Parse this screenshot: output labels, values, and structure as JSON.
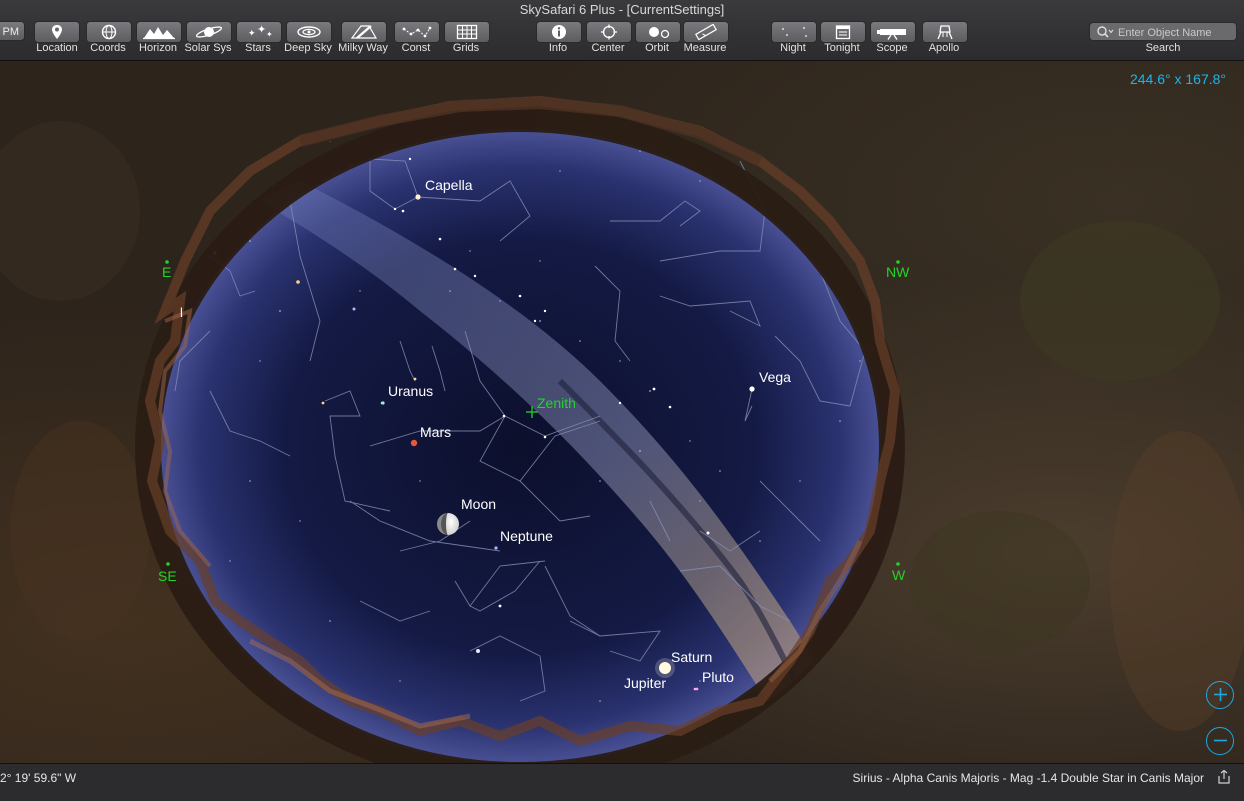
{
  "window": {
    "title": "SkySafari 6 Plus - [CurrentSettings]"
  },
  "toolbar": {
    "partial_label": "PM",
    "buttons": [
      {
        "id": "location",
        "label": "Location",
        "icon": "location-pin-icon"
      },
      {
        "id": "coords",
        "label": "Coords",
        "icon": "coords-icon"
      },
      {
        "id": "horizon",
        "label": "Horizon",
        "icon": "horizon-icon"
      },
      {
        "id": "solar-sys",
        "label": "Solar Sys",
        "icon": "planet-icon"
      },
      {
        "id": "stars",
        "label": "Stars",
        "icon": "stars-icon"
      },
      {
        "id": "deep-sky",
        "label": "Deep Sky",
        "icon": "galaxy-icon"
      },
      {
        "id": "milky-way",
        "label": "Milky Way",
        "icon": "milky-way-icon"
      },
      {
        "id": "const",
        "label": "Const",
        "icon": "constellation-icon"
      },
      {
        "id": "grids",
        "label": "Grids",
        "icon": "grid-icon"
      },
      {
        "id": "info",
        "label": "Info",
        "icon": "info-icon"
      },
      {
        "id": "center",
        "label": "Center",
        "icon": "crosshair-icon"
      },
      {
        "id": "orbit",
        "label": "Orbit",
        "icon": "orbit-icon"
      },
      {
        "id": "measure",
        "label": "Measure",
        "icon": "ruler-icon"
      },
      {
        "id": "night",
        "label": "Night",
        "icon": "moon-icon"
      },
      {
        "id": "tonight",
        "label": "Tonight",
        "icon": "calendar-icon"
      },
      {
        "id": "scope",
        "label": "Scope",
        "icon": "telescope-icon"
      },
      {
        "id": "apollo",
        "label": "Apollo",
        "icon": "lunar-lander-icon"
      }
    ],
    "search": {
      "placeholder": "Enter Object Name",
      "label": "Search"
    }
  },
  "sky": {
    "fov": "244.6° x 167.8°",
    "zenith": "Zenith",
    "compass": [
      "E",
      "NW",
      "SE",
      "W"
    ],
    "partial_label": "l",
    "objects": [
      "Capella",
      "Uranus",
      "Mars",
      "Moon",
      "Neptune",
      "Vega",
      "Saturn",
      "Jupiter",
      "Pluto"
    ]
  },
  "status": {
    "left": "2° 19' 59.6\" W",
    "right": "Sirius - Alpha Canis Majoris - Mag -1.4 Double Star in Canis Major"
  },
  "colors": {
    "accent": "#1ea7e0",
    "compass": "#22d42a",
    "label": "#ffffff"
  }
}
